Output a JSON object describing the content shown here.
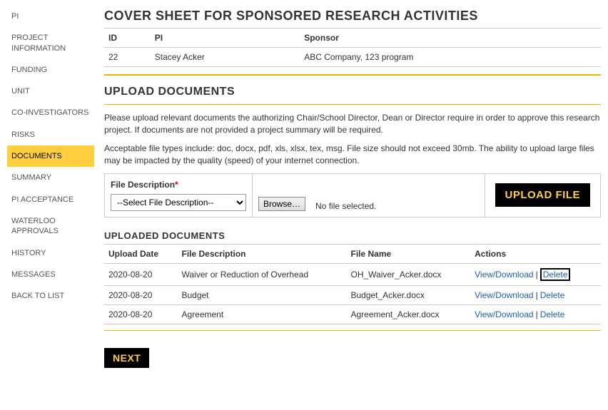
{
  "sidebar": {
    "items": [
      {
        "label": "PI"
      },
      {
        "label": "PROJECT INFORMATION"
      },
      {
        "label": "FUNDING"
      },
      {
        "label": "UNIT"
      },
      {
        "label": "CO-INVESTIGATORS"
      },
      {
        "label": "RISKS"
      },
      {
        "label": "DOCUMENTS"
      },
      {
        "label": "SUMMARY"
      },
      {
        "label": "PI ACCEPTANCE"
      },
      {
        "label": "WATERLOO APPROVALS"
      },
      {
        "label": "HISTORY"
      },
      {
        "label": "MESSAGES"
      },
      {
        "label": "BACK TO LIST"
      }
    ],
    "active_index": 6
  },
  "header": {
    "title": "COVER SHEET FOR SPONSORED RESEARCH ACTIVITIES",
    "cols": {
      "id": "ID",
      "pi": "PI",
      "sponsor": "Sponsor"
    },
    "row": {
      "id": "22",
      "pi": "Stacey Acker",
      "sponsor": "ABC Company, 123 program"
    }
  },
  "upload_section": {
    "title": "UPLOAD DOCUMENTS",
    "para1": "Please upload relevant documents the authorizing Chair/School Director, Dean or Director require in order to approve this research project. If documents are not provided a project summary will be required.",
    "para2": "Acceptable file types include: doc, docx, pdf, xls, xlsx, tex, msg. File size should not exceed 30mb. The ability to upload large files may be impacted by the quality (speed) of your internet connection.",
    "file_desc_label": "File Description",
    "select_placeholder": "--Select File Description--",
    "browse_label": "Browse…",
    "no_file_text": "No file selected.",
    "upload_btn": "UPLOAD FILE"
  },
  "uploaded": {
    "title": "UPLOADED DOCUMENTS",
    "cols": {
      "date": "Upload Date",
      "desc": "File Description",
      "file": "File Name",
      "actions": "Actions"
    },
    "action_labels": {
      "view": "View/Download",
      "delete": "Delete"
    },
    "rows": [
      {
        "date": "2020-08-20",
        "desc": "Waiver or Reduction of Overhead",
        "file": "OH_Waiver_Acker.docx"
      },
      {
        "date": "2020-08-20",
        "desc": "Budget",
        "file": "Budget_Acker.docx"
      },
      {
        "date": "2020-08-20",
        "desc": "Agreement",
        "file": "Agreement_Acker.docx"
      }
    ],
    "highlight_row": 0
  },
  "footer": {
    "next": "NEXT"
  }
}
